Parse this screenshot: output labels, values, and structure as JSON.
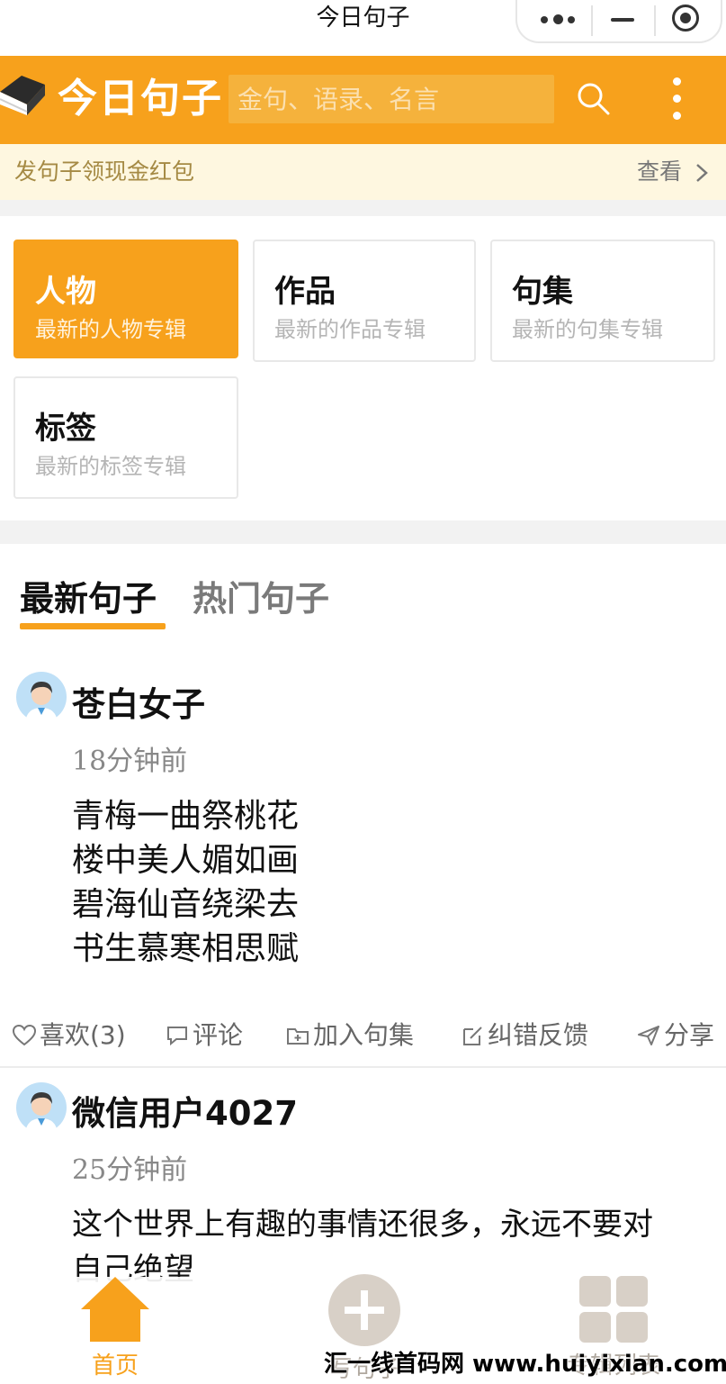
{
  "window": {
    "title": "今日句子"
  },
  "header": {
    "logo_text": "今日句子",
    "search_placeholder": "金句、语录、名言"
  },
  "promo": {
    "text": "发句子领现金红包",
    "link": "查看"
  },
  "categories": [
    {
      "title": "人物",
      "subtitle": "最新的人物专辑",
      "active": true
    },
    {
      "title": "作品",
      "subtitle": "最新的作品专辑",
      "active": false
    },
    {
      "title": "句集",
      "subtitle": "最新的句集专辑",
      "active": false
    },
    {
      "title": "标签",
      "subtitle": "最新的标签专辑",
      "active": false
    }
  ],
  "tabs": [
    {
      "label": "最新句子",
      "active": true
    },
    {
      "label": "热门句子",
      "active": false
    }
  ],
  "posts": [
    {
      "username": "苍白女子",
      "time": "18分钟前",
      "lines": [
        "青梅一曲祭桃花",
        "楼中美人媚如画",
        "碧海仙音绕梁去",
        "书生慕寒相思赋"
      ],
      "actions": {
        "like": "喜欢(3)",
        "comment": "评论",
        "add": "加入句集",
        "report": "纠错反馈",
        "share": "分享"
      }
    },
    {
      "username": "微信用户4027",
      "time": "25分钟前",
      "lines": [
        "这个世界上有趣的事情还很多，永远不要对",
        "自己绝望"
      ]
    }
  ],
  "bottom_nav": [
    {
      "label": "首页",
      "icon": "home-icon",
      "active": true
    },
    {
      "label": "写句子",
      "icon": "plus-circle-icon",
      "active": false
    },
    {
      "label": "专辑列表",
      "icon": "grid-icon",
      "active": false
    }
  ],
  "watermark": "汇一线首码网 www.huiyixian.com",
  "colors": {
    "accent": "#f7a11c",
    "promo_bg": "#fef7e0",
    "promo_text": "#a58a44",
    "inactive_nav": "#d8d0c7"
  }
}
